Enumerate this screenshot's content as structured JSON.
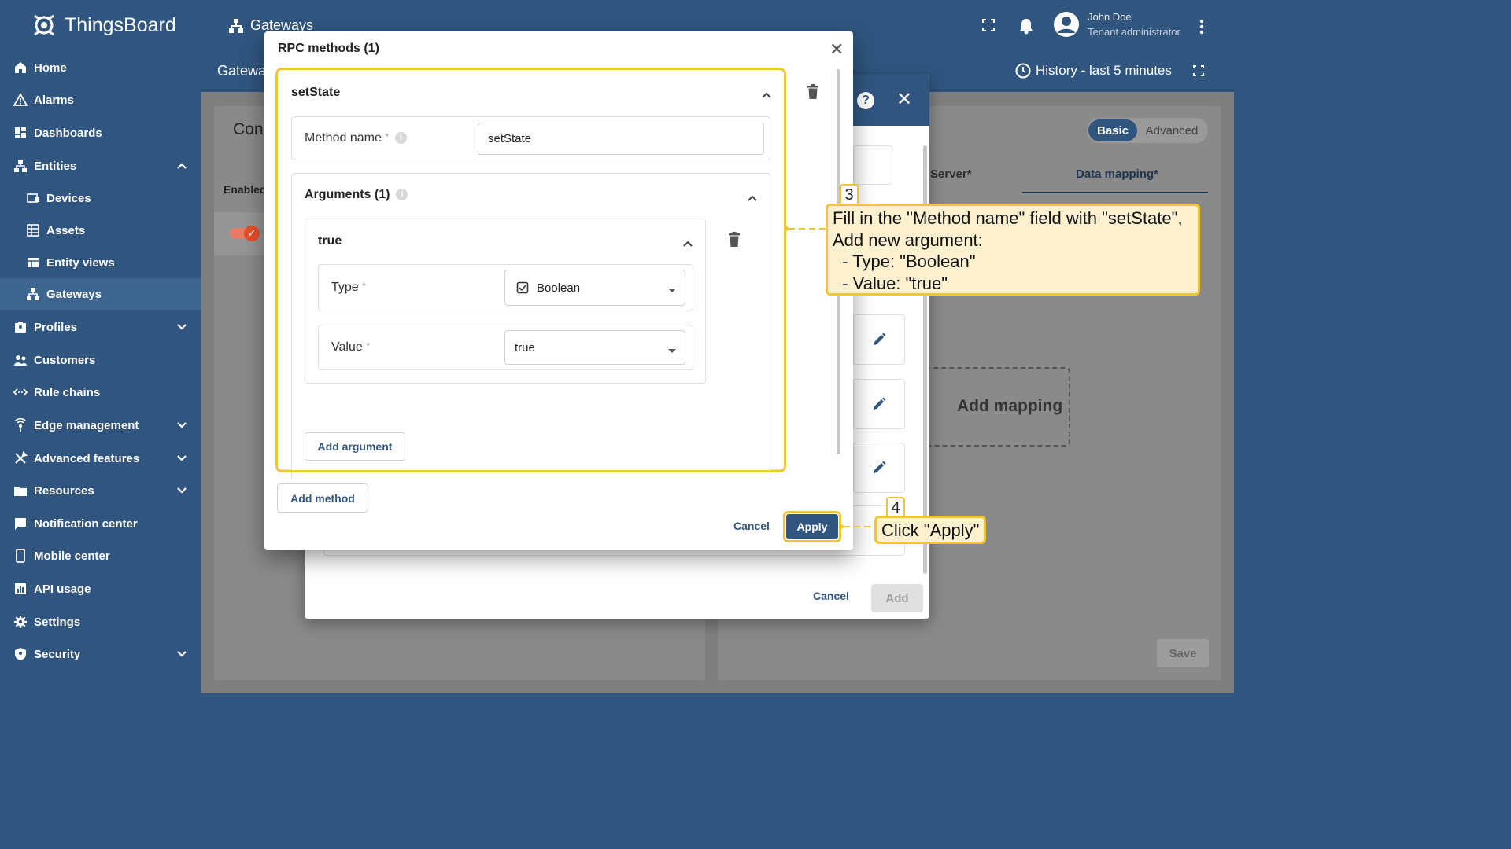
{
  "app": {
    "name": "ThingsBoard"
  },
  "topbar": {
    "section_title": "Gateways",
    "breadcrumb_partial": "Gatewa",
    "history_label": "History - last 5 minutes"
  },
  "user": {
    "name": "John Doe",
    "role": "Tenant administrator"
  },
  "sidebar": {
    "items": [
      {
        "label": "Home",
        "icon": "home-icon"
      },
      {
        "label": "Alarms",
        "icon": "alarm-icon"
      },
      {
        "label": "Dashboards",
        "icon": "dashboard-icon"
      },
      {
        "label": "Entities",
        "icon": "entities-icon",
        "expanded": true
      },
      {
        "label": "Devices",
        "icon": "device-icon"
      },
      {
        "label": "Assets",
        "icon": "asset-icon"
      },
      {
        "label": "Entity views",
        "icon": "entity-view-icon"
      },
      {
        "label": "Gateways",
        "icon": "gateway-icon",
        "active": true
      },
      {
        "label": "Profiles",
        "icon": "profiles-icon"
      },
      {
        "label": "Customers",
        "icon": "customers-icon"
      },
      {
        "label": "Rule chains",
        "icon": "rule-chain-icon"
      },
      {
        "label": "Edge management",
        "icon": "edge-icon"
      },
      {
        "label": "Advanced features",
        "icon": "tools-icon"
      },
      {
        "label": "Resources",
        "icon": "folder-icon"
      },
      {
        "label": "Notification center",
        "icon": "notification-icon"
      },
      {
        "label": "Mobile center",
        "icon": "mobile-icon"
      },
      {
        "label": "API usage",
        "icon": "chart-icon"
      },
      {
        "label": "Settings",
        "icon": "settings-icon"
      },
      {
        "label": "Security",
        "icon": "security-icon"
      }
    ]
  },
  "background": {
    "left_card_title": "Con",
    "enabled_label": "Enabled",
    "toggle_basic": "Basic",
    "toggle_advanced": "Advanced",
    "tab_server": "Server*",
    "tab_data_mapping": "Data mapping*",
    "add_mapping": "Add mapping",
    "save": "Save"
  },
  "secondary_dialog": {
    "cancel": "Cancel",
    "add": "Add"
  },
  "dialog": {
    "title": "RPC methods (1)",
    "method": {
      "header": "setState",
      "method_name_label": "Method name",
      "method_name_value": "setState",
      "arguments_title": "Arguments (1)",
      "argument": {
        "header": "true",
        "type_label": "Type",
        "type_value": "Boolean",
        "value_label": "Value",
        "value_value": "true"
      },
      "add_argument": "Add argument"
    },
    "add_method": "Add method",
    "cancel": "Cancel",
    "apply": "Apply"
  },
  "annotations": {
    "step3_number": "3",
    "step3_lines": [
      "Fill in the \"Method name\" field with \"setState\",",
      "Add new argument:",
      "  - Type: \"Boolean\"",
      "  - Value: \"true\""
    ],
    "step4_number": "4",
    "step4_text": "Click \"Apply\""
  },
  "colors": {
    "primary": "#305680",
    "accent": "#f2c437",
    "callout_bg": "#fdf0cf",
    "toggle_on": "#e6502c"
  }
}
